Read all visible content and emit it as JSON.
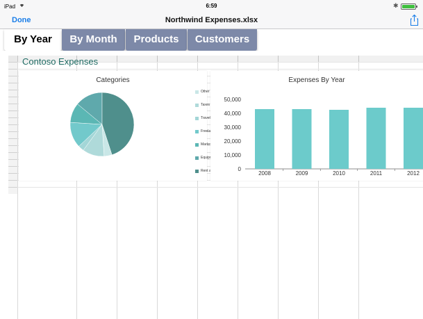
{
  "status_bar": {
    "device": "iPad",
    "time": "6:59",
    "battery_pct": 1.0
  },
  "nav_bar": {
    "done_label": "Done",
    "title": "Northwind Expenses.xlsx"
  },
  "tabs": [
    {
      "label": "By Year",
      "active": true
    },
    {
      "label": "By Month",
      "active": false
    },
    {
      "label": "Products",
      "active": false
    },
    {
      "label": "Customers",
      "active": false
    }
  ],
  "sheet": {
    "title": "Contoso Expenses"
  },
  "colors": {
    "tab_inactive": "#7d89a8",
    "accent_blue": "#1a7ee8",
    "bar": "#6ccbcb",
    "title_text": "#1f6b63"
  },
  "chart_data": [
    {
      "type": "pie",
      "title": "Categories",
      "legend_position": "right",
      "categories": [
        "Other",
        "Taxes",
        "Travel",
        "Freelancers",
        "Marketing",
        "Equipment",
        "Rent and Util"
      ],
      "values": [
        4,
        11,
        3,
        13,
        10,
        14,
        45
      ],
      "colors": [
        "#c9e7e7",
        "#afdada",
        "#a3d6d7",
        "#72c9cb",
        "#5bb7b4",
        "#5fa9ac",
        "#4f8f8c"
      ]
    },
    {
      "type": "bar",
      "title": "Expenses By Year",
      "categories": [
        "2008",
        "2009",
        "2010",
        "2011",
        "2012"
      ],
      "values": [
        43000,
        43000,
        42500,
        44000,
        44000
      ],
      "ylim": [
        0,
        50000
      ],
      "yticks": [
        "0",
        "10,000",
        "20,000",
        "30,000",
        "40,000",
        "50,000"
      ],
      "grid": false,
      "color": "#6ccbcb"
    }
  ]
}
